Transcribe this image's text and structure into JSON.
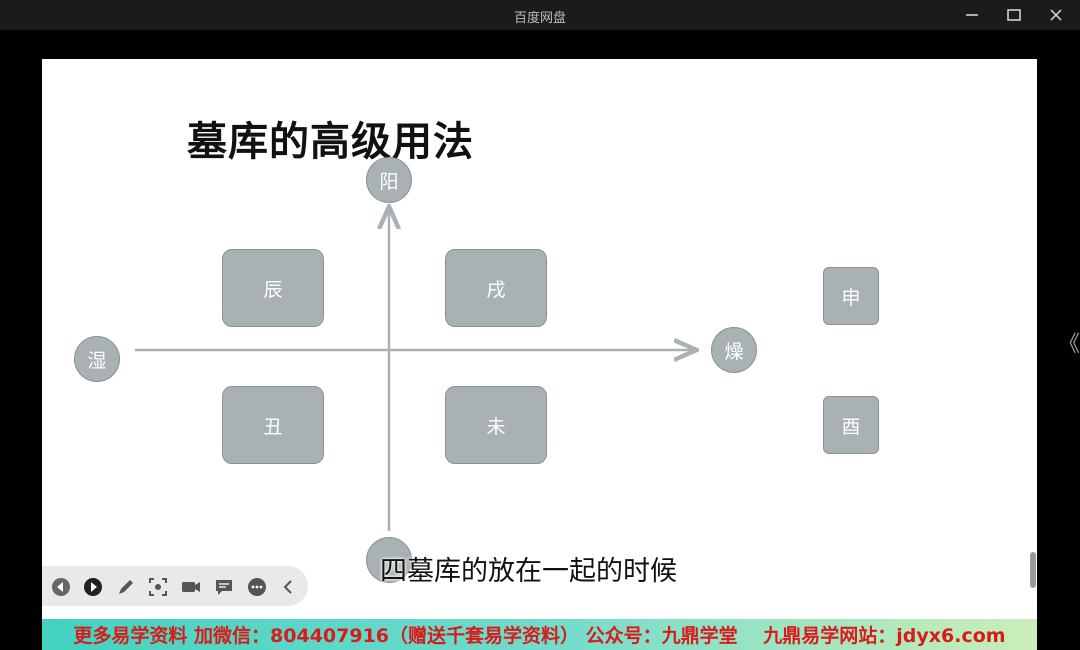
{
  "window": {
    "title": "百度网盘"
  },
  "slide": {
    "title": "墓库的高级用法",
    "axis_labels": {
      "top": "阳",
      "left": "湿",
      "right": "燥",
      "bottom": ""
    },
    "boxes": {
      "chen": "辰",
      "xu": "戌",
      "chou": "丑",
      "wei": "未"
    },
    "side_boxes": {
      "shen": "申",
      "you": "酉"
    }
  },
  "subtitle": "四墓库的放在一起的时候",
  "banner": "更多易学资料 加微信：804407916（赠送千套易学资料） 公众号：九鼎学堂　 九鼎易学网站：jdyx6.com",
  "colors": {
    "node_fill": "#a9b1b5",
    "axis": "#a9b1b5",
    "banner_text": "#d81b1b"
  },
  "toolbar_icons": [
    "prev-icon",
    "play-icon",
    "pen-icon",
    "screenshot-icon",
    "camera-icon",
    "comment-icon",
    "more-icon",
    "collapse-icon"
  ],
  "side_arrow": "《"
}
